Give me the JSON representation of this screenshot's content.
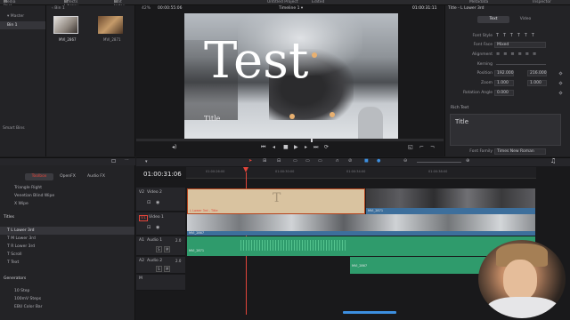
{
  "topbar": {
    "media_pool": "Media Pool",
    "effects_library": "Effects Library",
    "edit_index": "Edit Index",
    "project_title": "Untitled Project",
    "edited": "Edited",
    "metadata": "Metadata",
    "inspector": "Inspector"
  },
  "media_pool": {
    "bin": "Bin 1",
    "master": "Master",
    "bin_item": "Bin 1",
    "smart_bins": "Smart Bins",
    "clips": [
      {
        "name": "MVI_2867"
      },
      {
        "name": "MVI_2871"
      }
    ]
  },
  "viewer": {
    "zoom": "42%",
    "source_timecode": "00:00:55:06",
    "timeline_name": "Timeline 1",
    "record_timecode": "01:00:31:11",
    "frame_text": "Test",
    "lower_third_text": "Title"
  },
  "inspector": {
    "clip_title": "Title - L Lower 3rd",
    "tab_text": "Text",
    "tab_video": "Video",
    "font_style_label": "Font Style",
    "font_face_label": "Font Face",
    "font_face_value": "Mixed",
    "alignment_label": "Alignment",
    "kerning_label": "Kerning",
    "position_label": "Position",
    "position_x": "192.000",
    "position_y": "216.000",
    "zoom_label": "Zoom",
    "zoom_x": "1.000",
    "zoom_y": "1.000",
    "rotation_label": "Rotation Angle",
    "rotation_value": "0.000",
    "rich_text_label": "Rich Text",
    "rich_text_value": "Title",
    "font_family_label": "Font Family",
    "font_family_value": "Times New Roman"
  },
  "effects": {
    "tabs": [
      "Toolbox",
      "OpenFX",
      "Audio FX"
    ],
    "transitions": [
      "Triangle Right",
      "Venetian Blind Wipe",
      "X Wipe"
    ],
    "titles_header": "Titles",
    "titles": [
      "L Lower 3rd",
      "M Lower 3rd",
      "R Lower 3rd",
      "Scroll",
      "Text"
    ],
    "generators_header": "Generators",
    "generators": [
      "10 Step",
      "100mV Steps",
      "EBU Color Bar"
    ]
  },
  "timeline": {
    "timecode": "01:00:31:06",
    "ruler_marks": [
      "01:00:26:00",
      "01:00:30:00",
      "01:00:34:00",
      "01:00:38:00"
    ],
    "tracks": [
      {
        "id": "V2",
        "name": "Video 2"
      },
      {
        "id": "V1",
        "name": "Video 1"
      },
      {
        "id": "A1",
        "name": "Audio 1",
        "ch": "2.0"
      },
      {
        "id": "A2",
        "name": "Audio 2",
        "ch": "2.0"
      },
      {
        "id": "M",
        "name": ""
      }
    ],
    "clips": {
      "title_clip": "L Lower 3rd - Title",
      "video_clip_a": "MVI_2867",
      "video_clip_b": "MVI_2871",
      "audio_clip_a": "MVI_2871",
      "audio_clip_b": "MVI_2867"
    }
  },
  "colors": {
    "accent_red": "#e2453a",
    "title_clip": "#d9c3a0",
    "video_clip": "#3d6f9c",
    "audio_clip": "#2f9b6c",
    "blue_selection": "#3d8fe0"
  }
}
